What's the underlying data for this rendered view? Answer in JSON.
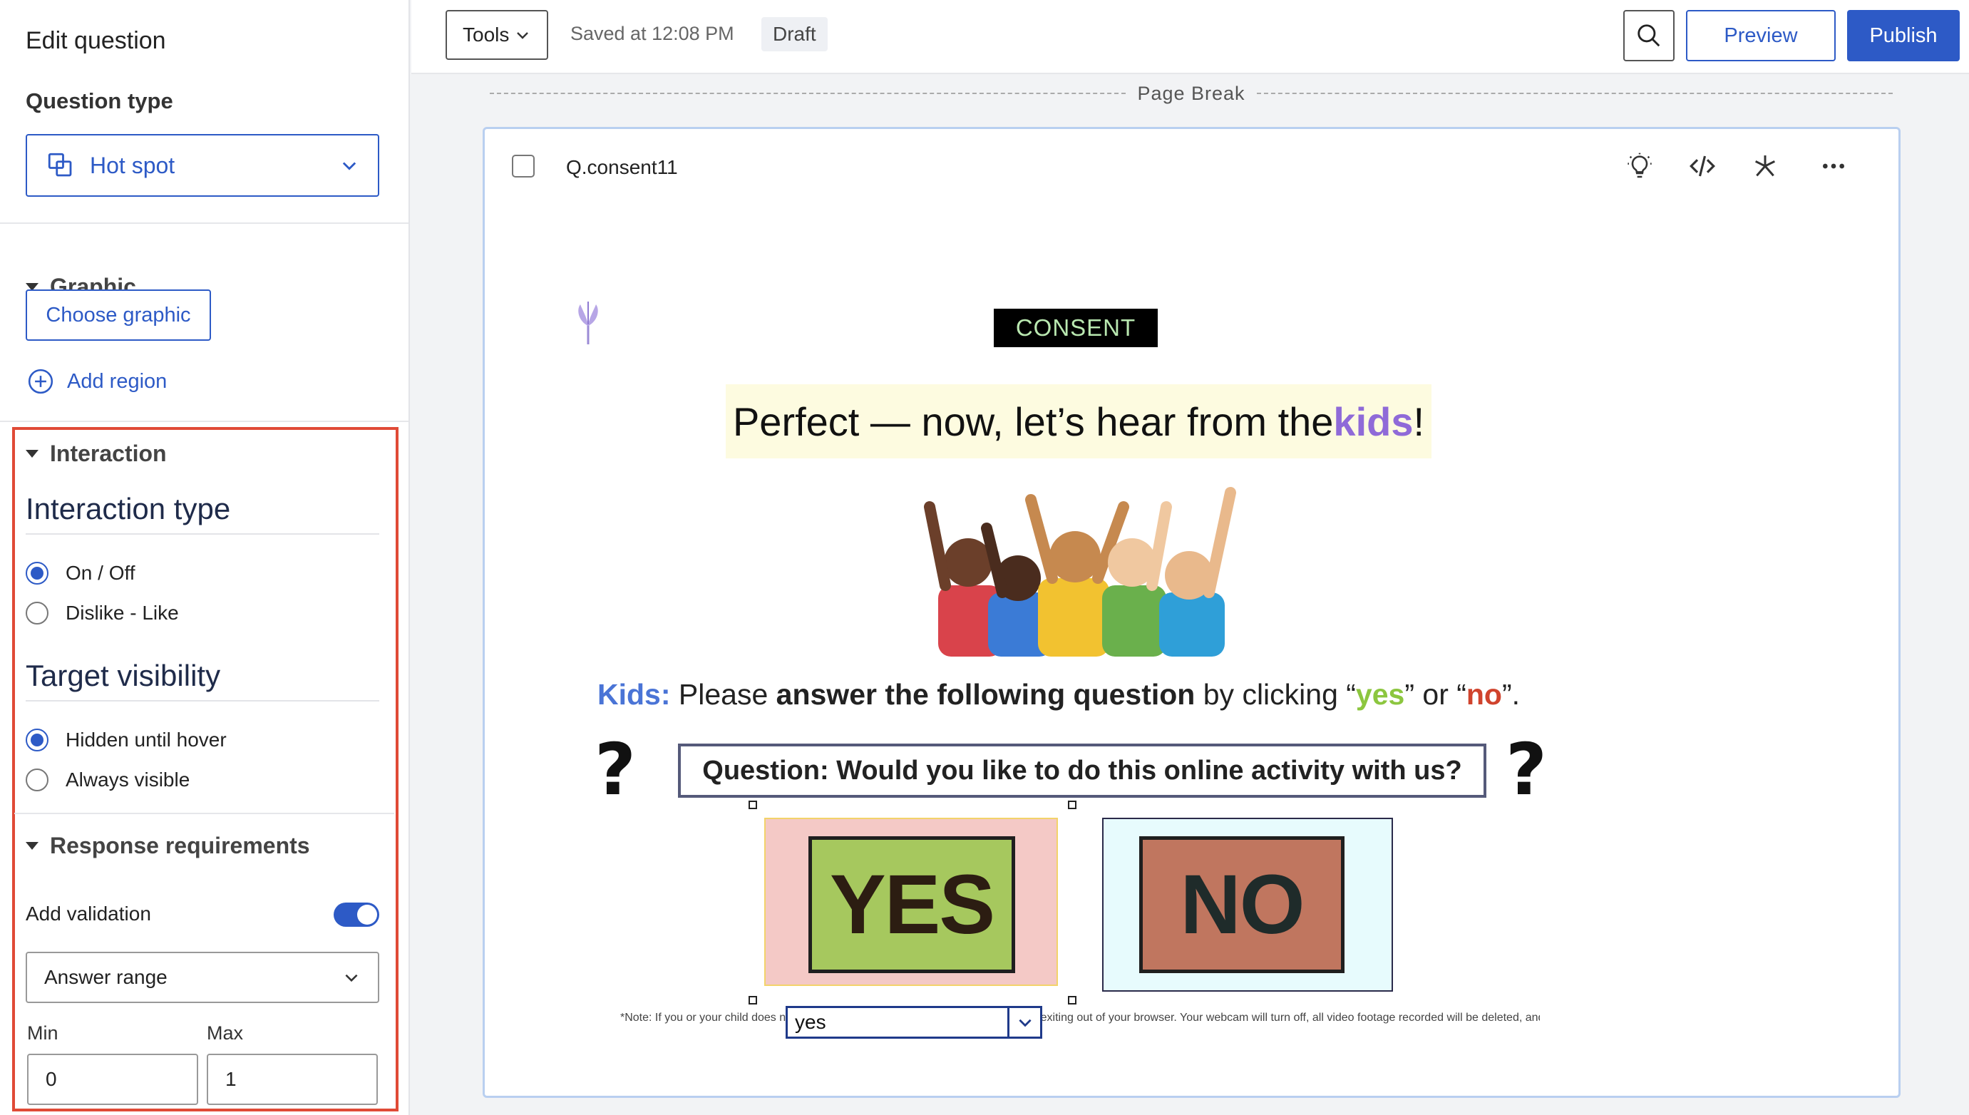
{
  "sidebar": {
    "title": "Edit question",
    "question_type_label": "Question type",
    "question_type_value": "Hot spot",
    "graphic_section": "Graphic",
    "choose_graphic": "Choose graphic",
    "add_region": "Add region",
    "interaction_section": "Interaction",
    "interaction_type_heading": "Interaction type",
    "interaction_options": [
      {
        "label": "On / Off",
        "selected": true
      },
      {
        "label": "Dislike - Like",
        "selected": false
      }
    ],
    "target_visibility_heading": "Target visibility",
    "visibility_options": [
      {
        "label": "Hidden until hover",
        "selected": true
      },
      {
        "label": "Always visible",
        "selected": false
      }
    ],
    "response_section": "Response requirements",
    "add_validation_label": "Add validation",
    "add_validation_on": true,
    "validation_type": "Answer range",
    "min_label": "Min",
    "max_label": "Max",
    "min_value": "0",
    "max_value": "1"
  },
  "topbar": {
    "tools": "Tools",
    "saved": "Saved at 12:08 PM",
    "status": "Draft",
    "preview": "Preview",
    "publish": "Publish"
  },
  "canvas": {
    "page_break": "Page Break",
    "question_id": "Q.consent11",
    "graphic": {
      "consent_tag": "CONSENT",
      "headline_part1": "Perfect — now, let’s hear from the ",
      "headline_kids": "kids",
      "headline_end": "!",
      "instruction_kids": "Kids:",
      "instruction_part1": " Please ",
      "instruction_bold": "answer the following question",
      "instruction_part2": " by clicking “",
      "instruction_yes": "yes",
      "instruction_part3": "” or “",
      "instruction_no": "no",
      "instruction_end": "”.",
      "qmark": "?",
      "question": "Question: Would you like to do this online activity with us?",
      "yes_button": "YES",
      "no_button": "NO",
      "note": "*Note: If you or your child does not want to participate, you may leave this study by exiting out of your browser. Your webcam will turn off, all video footage recorded will be deleted, and the file will be destroyed."
    },
    "region_select_value": "yes"
  },
  "colors": {
    "accent": "#2d5ac6",
    "highlight_border": "#e04a36"
  }
}
